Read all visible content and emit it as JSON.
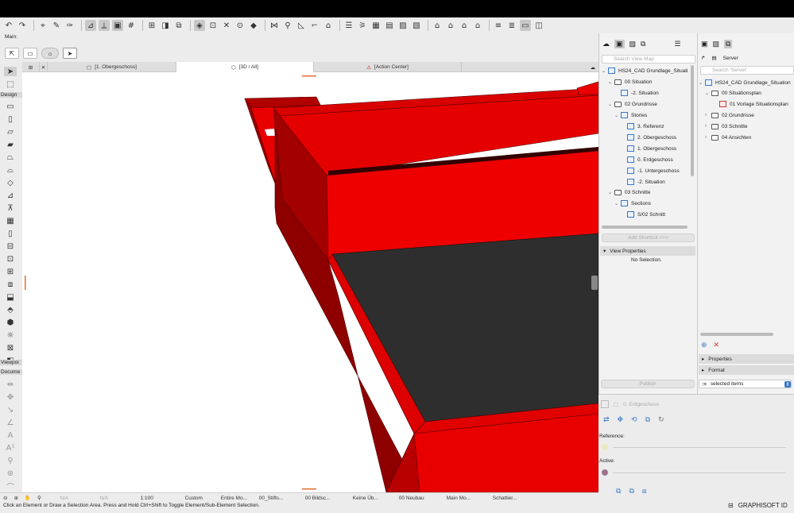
{
  "toolbar": {
    "main_label": "Main:"
  },
  "infobox": {
    "icons": [
      "arrow-select-icon"
    ]
  },
  "tabs": [
    {
      "label": "[1. Obergeschoss]"
    },
    {
      "label": "[3D / All]"
    },
    {
      "label": "[Action Center]"
    }
  ],
  "left_toolbox": {
    "design_label": "Design",
    "viewpoint_label": "Viewpoi",
    "document_label": "Docume"
  },
  "viewport": {
    "colors": {
      "red": "#e80000",
      "red_dark": "#b00000",
      "red_shade": "#8e0000",
      "floor": "#2e2e2e"
    }
  },
  "status": {
    "items": [
      "N/A",
      "N/A",
      "1:100",
      "Custom",
      "Entire Mo...",
      "00_Stifts...",
      "00 Bildsc...",
      "Keine Üb...",
      "00 Neubau",
      "Main Mo...",
      "Schattier..."
    ],
    "hint": "Click an Element or Draw a Selection Area. Press and Hold Ctrl+Shift to Toggle Element/Sub-Element Selection.",
    "brand": "GRAPHISOFT ID"
  },
  "navigator": {
    "search_placeholder": "Search View Map",
    "root": "HS24_CAD Grundlage_Situati",
    "items": [
      {
        "label": "00 Situation",
        "type": "folder"
      },
      {
        "label": "-2. Situation",
        "type": "view"
      },
      {
        "label": "02 Grundrisse",
        "type": "folder"
      },
      {
        "label": "Stories",
        "type": "stories"
      },
      {
        "label": "3. Referenz",
        "type": "view"
      },
      {
        "label": "2. Obergeschoss",
        "type": "view"
      },
      {
        "label": "1. Obergeschoss",
        "type": "view"
      },
      {
        "label": "0. Erdgeschoss",
        "type": "view"
      },
      {
        "label": "-1. Untergeschoss",
        "type": "view"
      },
      {
        "label": "-2. Situation",
        "type": "view"
      },
      {
        "label": "03 Schnitte",
        "type": "folder"
      },
      {
        "label": "Sections",
        "type": "stories"
      },
      {
        "label": "S/02 Schnitt",
        "type": "view"
      }
    ],
    "add_shortcut": "Add Shortcut >>>",
    "view_properties": "View Properties",
    "no_selection": "No Selection."
  },
  "publisher": {
    "server_label": "Server",
    "search_placeholder": "Search 'Server'",
    "root": "HS24_CAD Grundlage_Situation",
    "items": [
      {
        "label": "00 Situationsplan"
      },
      {
        "label": "01 Vorlage Situationsplan"
      },
      {
        "label": "02 Grundrisse"
      },
      {
        "label": "03 Schnitte"
      },
      {
        "label": "04 Ansichten"
      }
    ],
    "properties": "Properties",
    "format": "Format",
    "publish": "Publish",
    "selected_items": "selected items"
  },
  "lower": {
    "story": "0. Erdgeschoss",
    "reference": "Reference:",
    "active": "Active:"
  }
}
